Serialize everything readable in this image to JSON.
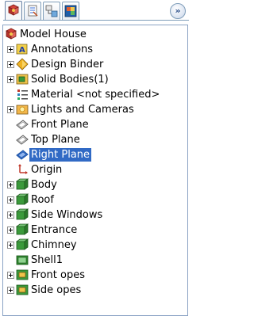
{
  "toolbar": {
    "tabs": [
      "feature-manager-icon",
      "property-manager-icon",
      "configuration-manager-icon",
      "display-manager-icon"
    ],
    "expand_label": "»"
  },
  "tree": {
    "root": "Model House",
    "items": [
      {
        "label": "Annotations",
        "icon": "annotations-icon",
        "expandable": true
      },
      {
        "label": "Design Binder",
        "icon": "design-binder-icon",
        "expandable": true
      },
      {
        "label": "Solid Bodies(1)",
        "icon": "solid-bodies-icon",
        "expandable": true
      },
      {
        "label": "Material <not specified>",
        "icon": "material-icon",
        "expandable": false
      },
      {
        "label": "Lights and Cameras",
        "icon": "lights-cameras-icon",
        "expandable": true
      },
      {
        "label": "Front Plane",
        "icon": "plane-icon",
        "expandable": false
      },
      {
        "label": "Top Plane",
        "icon": "plane-icon",
        "expandable": false
      },
      {
        "label": "Right Plane",
        "icon": "plane-icon",
        "expandable": false,
        "selected": true
      },
      {
        "label": "Origin",
        "icon": "origin-icon",
        "expandable": false
      },
      {
        "label": "Body",
        "icon": "feature-icon",
        "expandable": true
      },
      {
        "label": "Roof",
        "icon": "feature-icon",
        "expandable": true
      },
      {
        "label": "Side Windows",
        "icon": "feature-icon",
        "expandable": true
      },
      {
        "label": "Entrance",
        "icon": "feature-icon",
        "expandable": true
      },
      {
        "label": "Chimney",
        "icon": "feature-icon",
        "expandable": true
      },
      {
        "label": "Shell1",
        "icon": "shell-icon",
        "expandable": false
      },
      {
        "label": "Front opes",
        "icon": "cut-feature-icon",
        "expandable": true
      },
      {
        "label": "Side opes",
        "icon": "cut-feature-icon",
        "expandable": true
      }
    ]
  },
  "colors": {
    "selection": "#316ac5",
    "border": "#7f9db9"
  }
}
